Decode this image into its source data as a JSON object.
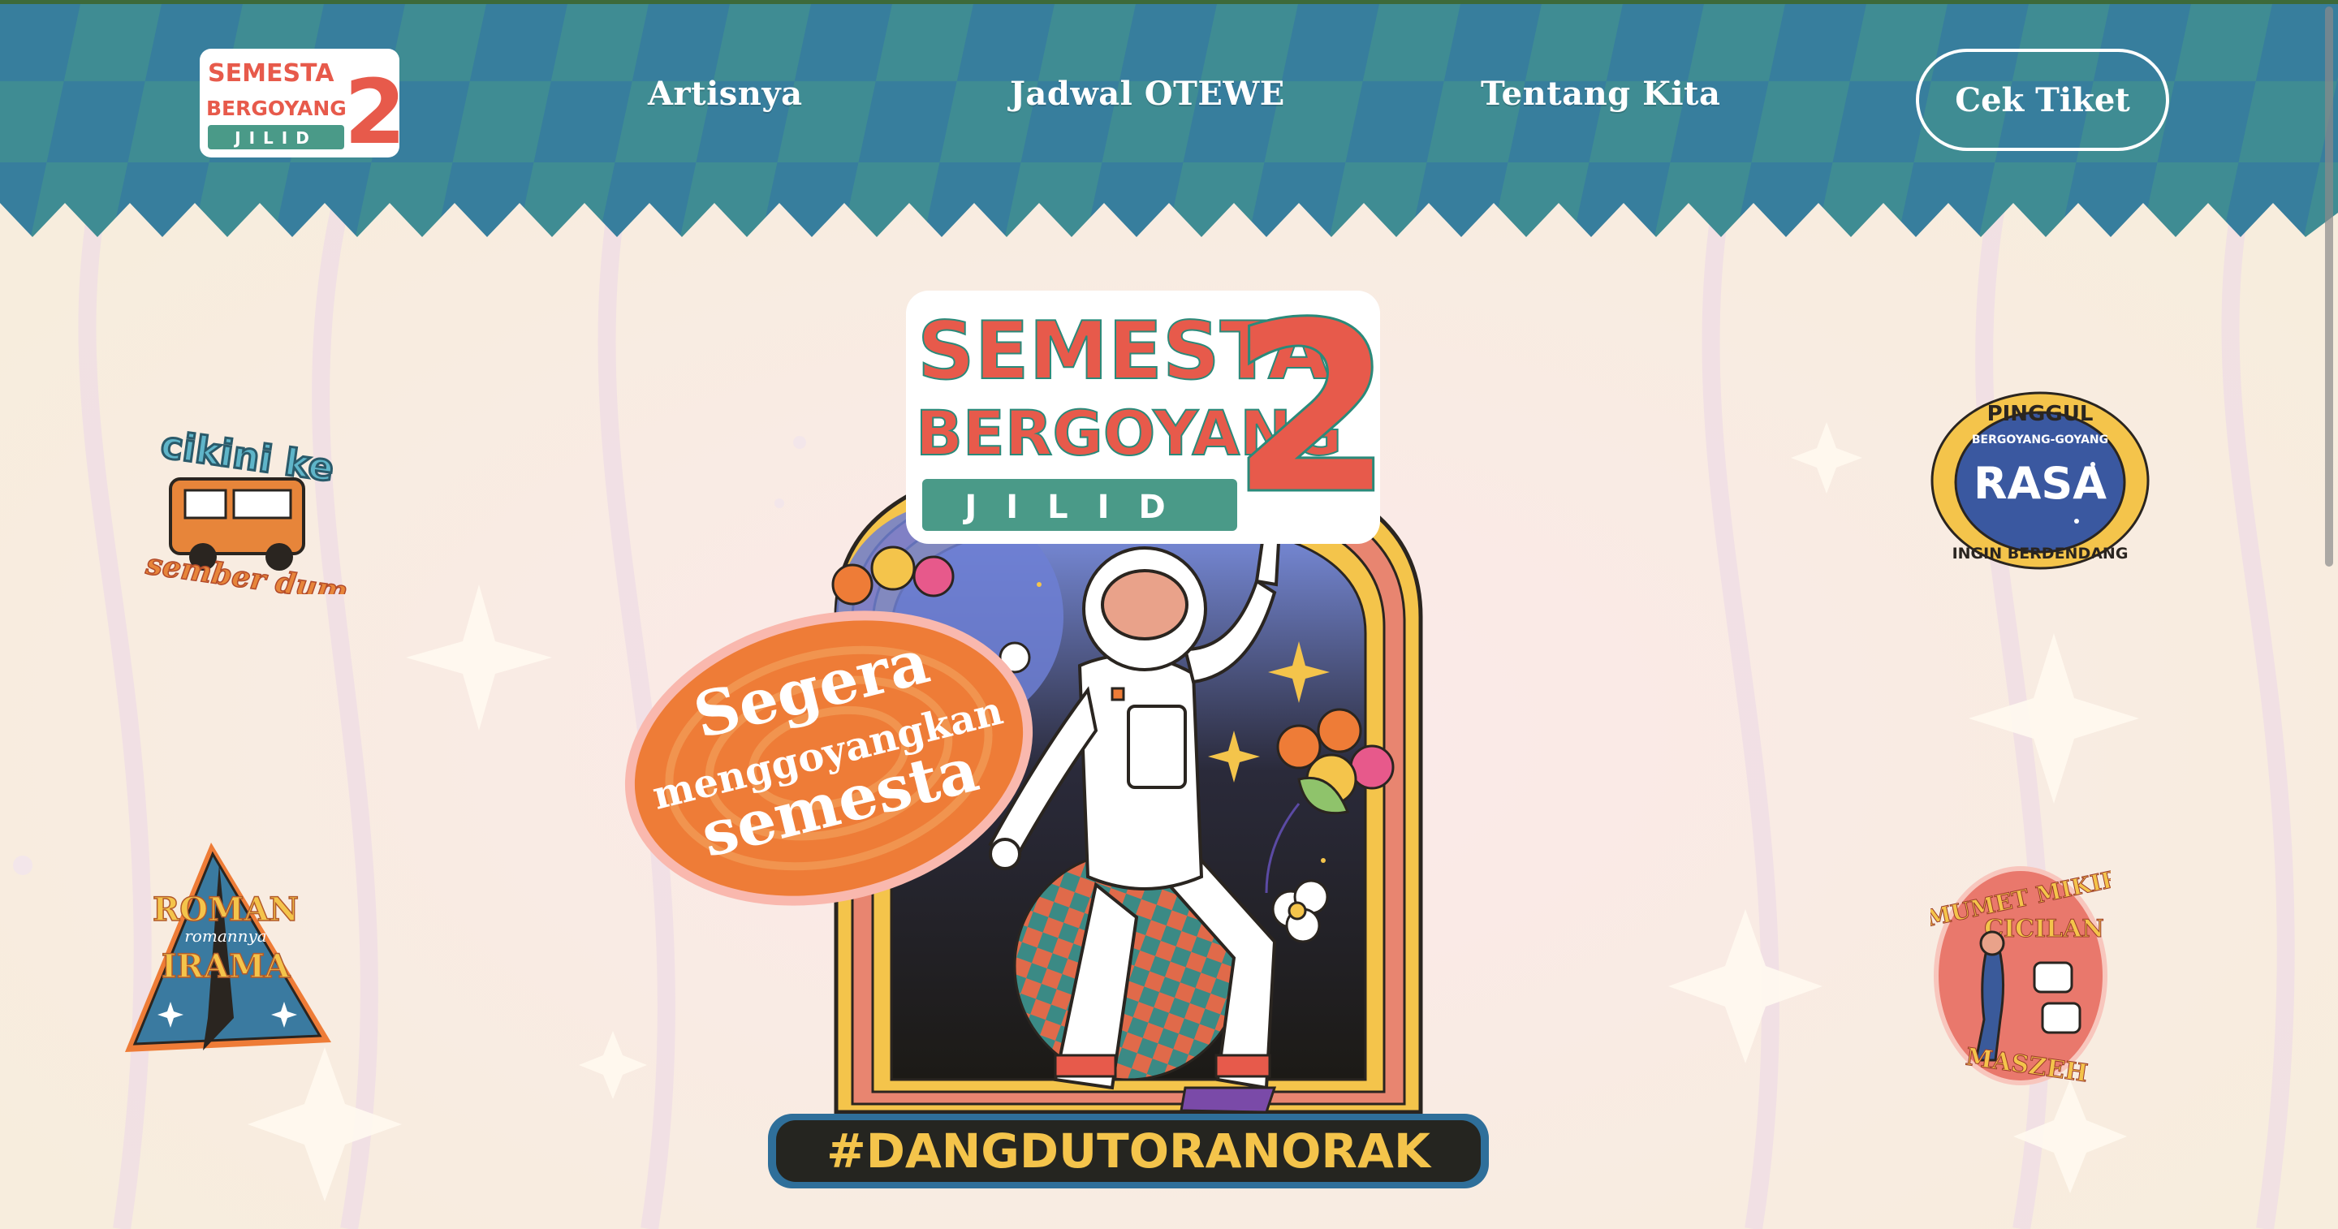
{
  "site": {
    "logo_lines": [
      "SEMESTA",
      "BERGOYANG",
      "JILID"
    ],
    "logo_number": "2"
  },
  "nav": {
    "links": [
      "Artisnya",
      "Jadwal OTEWE",
      "Tentang Kita"
    ],
    "cta_label": "Cek Tiket"
  },
  "hero": {
    "title_lines": [
      "SEMESTA",
      "BERGOYANG"
    ],
    "edition_label": "JILID",
    "edition_number": "2",
    "bubble_lines": [
      "Segera",
      "menggoyangkan",
      "semesta"
    ],
    "hashtag": "#DANGDUTORANORAK"
  },
  "stickers": {
    "van": {
      "top": "cikini ke",
      "bottom": "sember dum"
    },
    "rasa": {
      "top": "PINGGUL",
      "ring": "BERGOYANG-GOYANG",
      "center": "RASA",
      "bottom": "INGIN BERDENDANG"
    },
    "roman": {
      "line1": "ROMAN",
      "line2": "romannya",
      "line3": "IRAMA"
    },
    "mumet": {
      "line1": "MUMET MIKIR",
      "line2": "CICILAN",
      "line3": "MASZEH"
    }
  },
  "colors": {
    "header_blue": "#3a7fa0",
    "header_teal": "#3e8d8f",
    "accent_red": "#e75a4b",
    "accent_teal": "#4a9a88",
    "accent_orange": "#ee7c37",
    "accent_yellow": "#f4c44b",
    "background": "#f8ede7",
    "hashtag_bg": "#252520"
  }
}
